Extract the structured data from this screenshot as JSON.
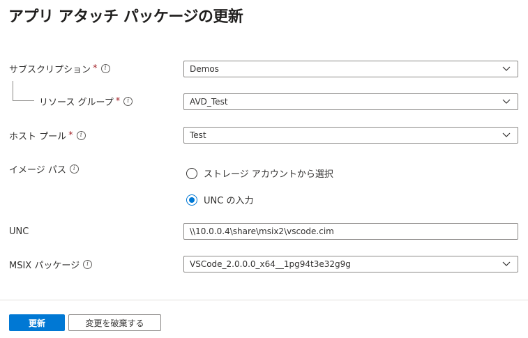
{
  "page": {
    "title": "アプリ アタッチ パッケージの更新",
    "more_label": "···"
  },
  "form": {
    "subscription": {
      "label": "サブスクリプション",
      "value": "Demos"
    },
    "resource_group": {
      "label": "リソース グループ",
      "value": "AVD_Test"
    },
    "host_pool": {
      "label": "ホスト プール",
      "value": "Test"
    },
    "image_path": {
      "label": "イメージ パス",
      "options": [
        "ストレージ アカウントから選択",
        "UNC の入力"
      ],
      "selected": "UNC の入力"
    },
    "unc": {
      "label": "UNC",
      "value": "\\\\10.0.0.4\\share\\msix2\\vscode.cim"
    },
    "msix_package": {
      "label": "MSIX パッケージ",
      "value": "VSCode_2.0.0.0_x64__1pg94t3e32g9g"
    },
    "required_mark": "*",
    "info_glyph": "i"
  },
  "footer": {
    "update_label": "更新",
    "discard_label": "変更を破棄する"
  },
  "colors": {
    "accent": "#0078d4",
    "required": "#a4262c",
    "border": "#8a8886"
  }
}
